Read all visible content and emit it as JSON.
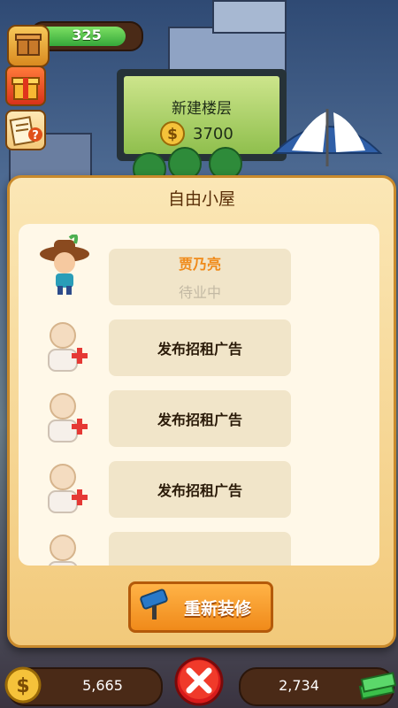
{
  "hud": {
    "xp_value": "325",
    "xp_progress": 0.82
  },
  "billboard": {
    "title": "新建楼层",
    "price": "3700"
  },
  "panel": {
    "title": "自由小屋",
    "slots": [
      {
        "type": "tenant",
        "name": "贾乃亮",
        "status": "待业中"
      },
      {
        "type": "vacant",
        "label": "发布招租广告"
      },
      {
        "type": "vacant",
        "label": "发布招租广告"
      },
      {
        "type": "vacant",
        "label": "发布招租广告"
      },
      {
        "type": "vacant",
        "label": ""
      }
    ],
    "renovate_label": "重新装修"
  },
  "bottom": {
    "coins": "5,665",
    "cash": "2,734"
  },
  "icons": {
    "crate": "crate-icon",
    "gift": "gift-icon",
    "quest": "quest-scroll-icon",
    "coin": "coin-icon",
    "cash": "cash-stack-icon",
    "close": "close-icon",
    "renovate": "paint-roller-icon",
    "add_tenant": "add-tenant-icon"
  },
  "colors": {
    "panel_bg": "#f2c97a",
    "accent_orange": "#f08a1a",
    "close_red": "#d81b1b",
    "xp_green": "#35a83a"
  }
}
